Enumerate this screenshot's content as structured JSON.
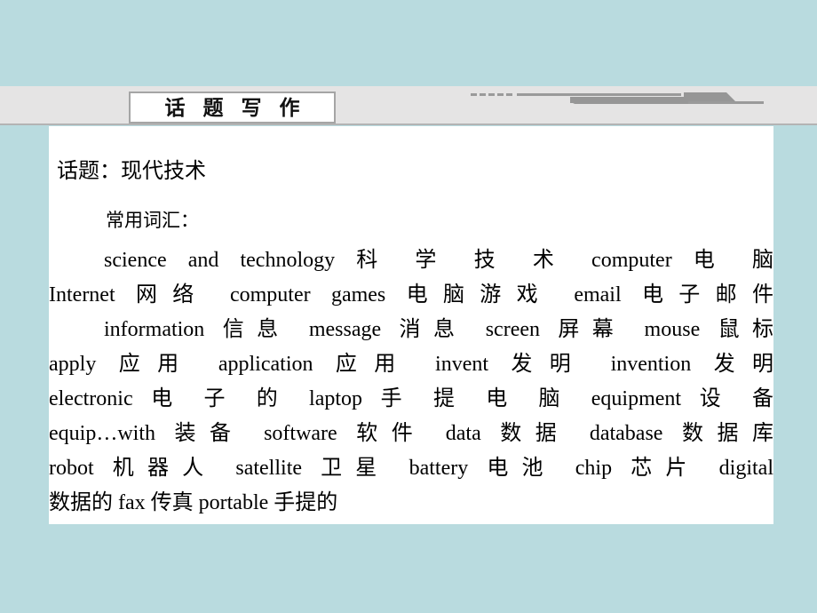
{
  "header": {
    "title": "话 题 写 作",
    "decoration": {
      "dash_count": 5,
      "line_color": "#9a9a9a",
      "shape_color": "#969696"
    },
    "band_color": "#e5e4e4"
  },
  "page": {
    "background_color": "#b9dbdf",
    "panel_background": "#ffffff"
  },
  "content": {
    "topic": "话题：现代技术",
    "section_heading": "常用词汇：",
    "vocab_lines": [
      "science  and  technology  科 学 技 术    computer  电 脑",
      "Internet 网络   computer games  电脑游戏   email  电子邮件",
      "information 信息   message 消息   screen 屏幕   mouse 鼠标",
      "apply 应用   application 应用   invent 发明   invention 发明",
      "electronic  电 子 的    laptop  手 提 电 脑   equipment  设 备",
      "equip…with 装备   software 软件   data 数据   database 数据库",
      "robot 机器人   satellite 卫星   battery 电池   chip 芯片   digital",
      "数据的   fax  传真   portable 手提的"
    ]
  }
}
